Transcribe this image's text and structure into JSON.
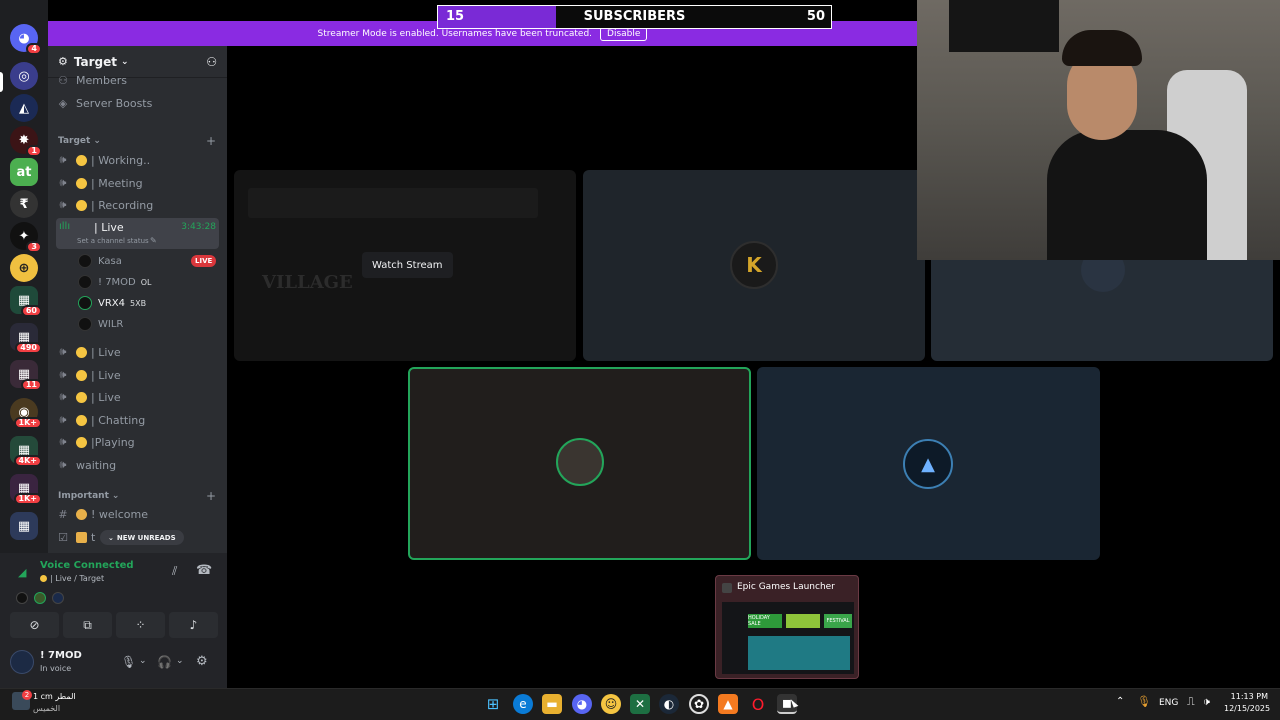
{
  "overlay": {
    "subs_current": "15",
    "subs_title": "SUBSCRIBERS",
    "subs_goal": "50",
    "subs_progress": 0.3,
    "streamer_mode_text": "Streamer Mode is enabled. Usernames have been truncated.",
    "disable_label": "Disable",
    "banner_color": "#8a2be2"
  },
  "server": {
    "name": "Target",
    "top_items": [
      "Members",
      "Server Boosts"
    ],
    "category_target": "Target",
    "category_important": "Important"
  },
  "channels": [
    {
      "label": "| Working.."
    },
    {
      "label": "| Meeting"
    },
    {
      "label": "| Recording"
    },
    {
      "label": "| Live",
      "timer": "3:43:28",
      "status": "Set a channel status"
    },
    {
      "label": "| Live"
    },
    {
      "label": "| Live"
    },
    {
      "label": "| Live"
    },
    {
      "label": "| Chatting"
    },
    {
      "label": "|Playing"
    },
    {
      "label": "waiting"
    }
  ],
  "voice_users": [
    {
      "name": "Kasa",
      "badge": "LIVE"
    },
    {
      "name": "! 7MOD",
      "tag": "OL"
    },
    {
      "name": "VRX4",
      "tag": "5XB"
    },
    {
      "name": "WILR"
    }
  ],
  "important_channels": [
    {
      "label": "! welcome"
    },
    {
      "label": "t"
    }
  ],
  "new_unreads": "NEW UNREADS",
  "servers": [
    {
      "badge": "4"
    },
    {
      "badge": ""
    },
    {
      "badge": ""
    },
    {
      "badge": "1"
    },
    {
      "badge": ""
    },
    {
      "badge": ""
    },
    {
      "badge": "3"
    },
    {
      "badge": ""
    },
    {
      "badge": "60"
    },
    {
      "badge": "490"
    },
    {
      "badge": "11"
    },
    {
      "badge": "1K+"
    },
    {
      "badge": "4K+"
    },
    {
      "badge": "1K+"
    }
  ],
  "voice_panel": {
    "status": "Voice Connected",
    "location": "| Live / Target",
    "username": "! 7MOD",
    "user_status": "In voice"
  },
  "stage": {
    "watch_stream": "Watch Stream",
    "game_logo": "VILLAGE"
  },
  "popup": {
    "title": "Epic Games Launcher",
    "thumb_tiles": [
      "HOLIDAY SALE",
      "FESTIVAL"
    ]
  },
  "taskbar": {
    "weather": "1 cm المطر",
    "weather_sub": "الخميس",
    "weather_badge": "2",
    "lang": "ENG",
    "time": "11:13 PM",
    "date": "12/15/2025"
  },
  "colors": {
    "accent_green": "#23a55a",
    "live_red": "#da373c",
    "discord_bg": "#2b2d31",
    "rail_bg": "#1e1f22"
  }
}
